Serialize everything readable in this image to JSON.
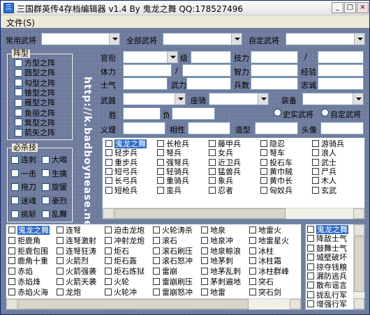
{
  "window": {
    "title": "三国群英传4存档编辑器 v1.4 By 鬼龙之舞 QQ:178527496",
    "app_icon": "三",
    "buttons": {
      "minimize": "_",
      "maximize": "□",
      "close": "×"
    }
  },
  "menu": {
    "file": "文件(S)"
  },
  "top": {
    "common_general": "常用武将",
    "all_general": "全部武将",
    "custom_general": "自定武将"
  },
  "formation": {
    "title": "阵型",
    "items": [
      "方型之阵",
      "圆型之阵",
      "勾型之阵",
      "锥型之阵",
      "雁型之阵",
      "鱼丽之阵",
      "箕型之阵",
      "箭矢之阵"
    ]
  },
  "skills": {
    "title": "必杀技",
    "items": [
      [
        "连刺",
        "大喝"
      ],
      [
        "一击",
        "生擒"
      ],
      [
        "拖刀",
        "旋锾"
      ],
      [
        "迷魂",
        "豪烈"
      ],
      [
        "挑斩",
        "乱舞"
      ]
    ]
  },
  "watermark": "http://k.badboynease.net",
  "stats": {
    "rank": "官衔",
    "level": "级",
    "skill_pts": "技力",
    "slash": "/",
    "stamina": "体力",
    "intel": "智力",
    "exp": "经验",
    "morale": "士气",
    "force": "武力",
    "soldiers": "兵数",
    "loyalty": "忠诚",
    "weapon": "武器",
    "mount": "座骑",
    "equip": "装备",
    "win": "胜",
    "lose": "负",
    "hist_gen": "史实武将",
    "custom_gen": "自定武将",
    "virtue": "义理",
    "compat": "相性",
    "model": "造型",
    "portrait": "头像"
  },
  "troops": {
    "col1": [
      "鬼龙之舞",
      "轻步兵",
      "重步兵",
      "短弓兵",
      "长弓兵",
      "短枪兵"
    ],
    "col2": [
      "长枪兵",
      "弩兵",
      "强弩兵",
      "轻骑兵",
      "重骑兵",
      "蛮兵"
    ],
    "col3": [
      "藤甲兵",
      "女兵",
      "近卫兵",
      "猛兽兵",
      "象兵",
      "忍者"
    ],
    "col4": [
      "隐忍",
      "弩车",
      "投石车",
      "黄巾贼",
      "黄巾长",
      "匈奴兵"
    ],
    "col5": [
      "游骑兵",
      "浪人",
      "武士",
      "尸兵",
      "木人",
      "玄武"
    ]
  },
  "tactics": {
    "col1": [
      "鬼龙之舞",
      "拒鹿角",
      "拒鹿包围",
      "鹿角十重",
      "赤焰",
      "赤焰烽",
      "赤焰火海"
    ],
    "col2": [
      "连弩",
      "连弩激射",
      "连弩狂涛",
      "火箭烈",
      "火箭强袭",
      "火箭天袭",
      "龙炮"
    ],
    "col3": [
      "迫击龙炮",
      "冲射龙炮",
      "炬石",
      "炬石轰",
      "炬石炼狱",
      "火轮",
      "火轮冲"
    ],
    "col4": [
      "火轮涛杀",
      "滚石",
      "滚石刷压",
      "滚石怒冲",
      "雷崩",
      "雷崩刷压",
      "雷崩怒冲"
    ],
    "col5": [
      "地泉",
      "地泉冲",
      "地泉鲸浪",
      "地茅刺",
      "地茅乱刺",
      "茅刺遍地",
      "地雷"
    ],
    "col6": [
      "地雷火",
      "地雷星火",
      "冰柱",
      "冰柱霜",
      "冰柱群峰",
      "突石",
      "突石剑"
    ]
  },
  "right_list": [
    "鬼龙之舞",
    "降敌士气",
    "鼓舞士气",
    "城壁破坏",
    "掠夺钱粮",
    "漏防逃兵",
    "散布谣言",
    "拢乱行军",
    "增强行军"
  ]
}
